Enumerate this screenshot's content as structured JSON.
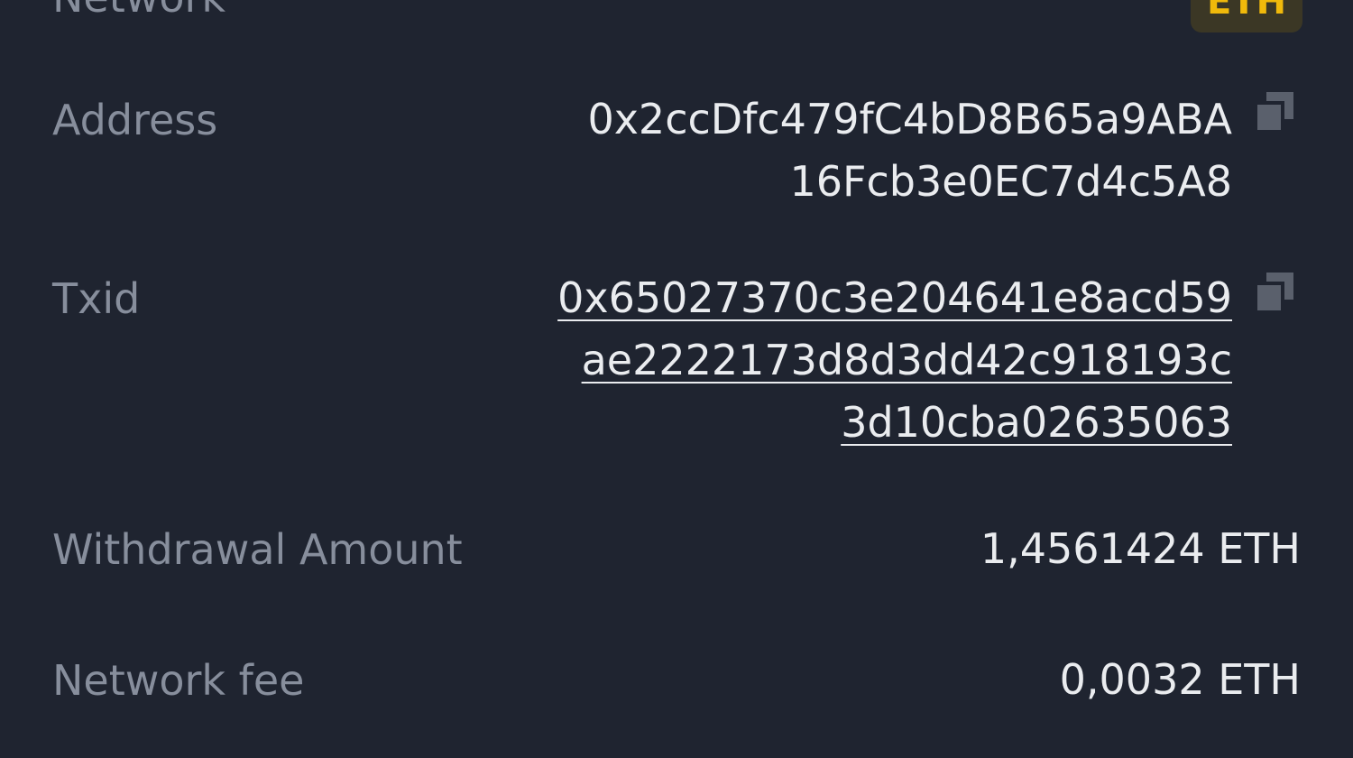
{
  "rows": {
    "network": {
      "label": "Network",
      "badge": "ETH"
    },
    "address": {
      "label": "Address",
      "lines": [
        "0x2ccDfc479fC4bD8B65a9ABA",
        "16Fcb3e0EC7d4c5A8"
      ],
      "icon": "copy-icon"
    },
    "txid": {
      "label": "Txid",
      "lines": [
        "0x65027370c3e204641e8acd59",
        "ae2222173d8d3dd42c918193c",
        "3d10cba02635063"
      ],
      "icon": "copy-icon"
    },
    "withdrawal_amount": {
      "label": "Withdrawal Amount",
      "value": "1,4561424 ETH"
    },
    "network_fee": {
      "label": "Network fee",
      "value": "0,0032 ETH"
    }
  },
  "colors": {
    "background": "#1f2430",
    "label": "#878e9c",
    "value": "#eaecef",
    "accent": "#f0b90b",
    "icon": "#5a606c"
  }
}
